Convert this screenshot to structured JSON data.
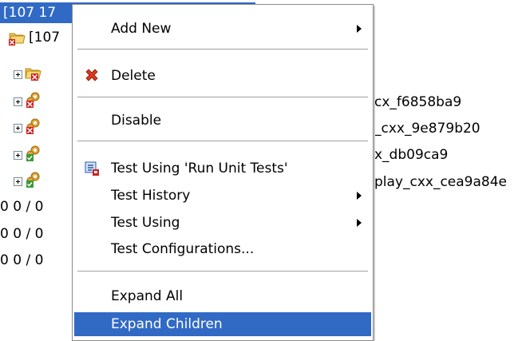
{
  "tree": {
    "selected_node_label": "[107 17",
    "root_label": "[107",
    "trailing_labels": [
      "cx_f6858ba9",
      "_cxx_9e879b20",
      "x_db09ca9",
      "play_cxx_cea9a84e"
    ],
    "zero_rows": [
      "0 0 / 0",
      "0 0 / 0",
      "0 0 / 0"
    ]
  },
  "menu": {
    "items": {
      "add_new": "Add New",
      "delete": "Delete",
      "disable": "Disable",
      "test_using_run_unit_tests": "Test Using 'Run Unit Tests'",
      "test_history": "Test History",
      "test_using": "Test Using",
      "test_configurations": "Test Configurations...",
      "expand_all": "Expand All",
      "expand_children": "Expand Children"
    },
    "highlighted_item": "Expand Children"
  },
  "colors": {
    "selection": "#316ac5",
    "delete_icon": "#d83a1f",
    "folder": "#f2c24a",
    "gear": "#e0a43a",
    "error_badge": "#d02020",
    "pass_badge": "#3a9a3a"
  },
  "icons": {
    "delete": "red-x-icon",
    "test_run": "unit-test-run-icon",
    "tree_folder": "folder-icon",
    "tree_gear": "gear-icon"
  }
}
